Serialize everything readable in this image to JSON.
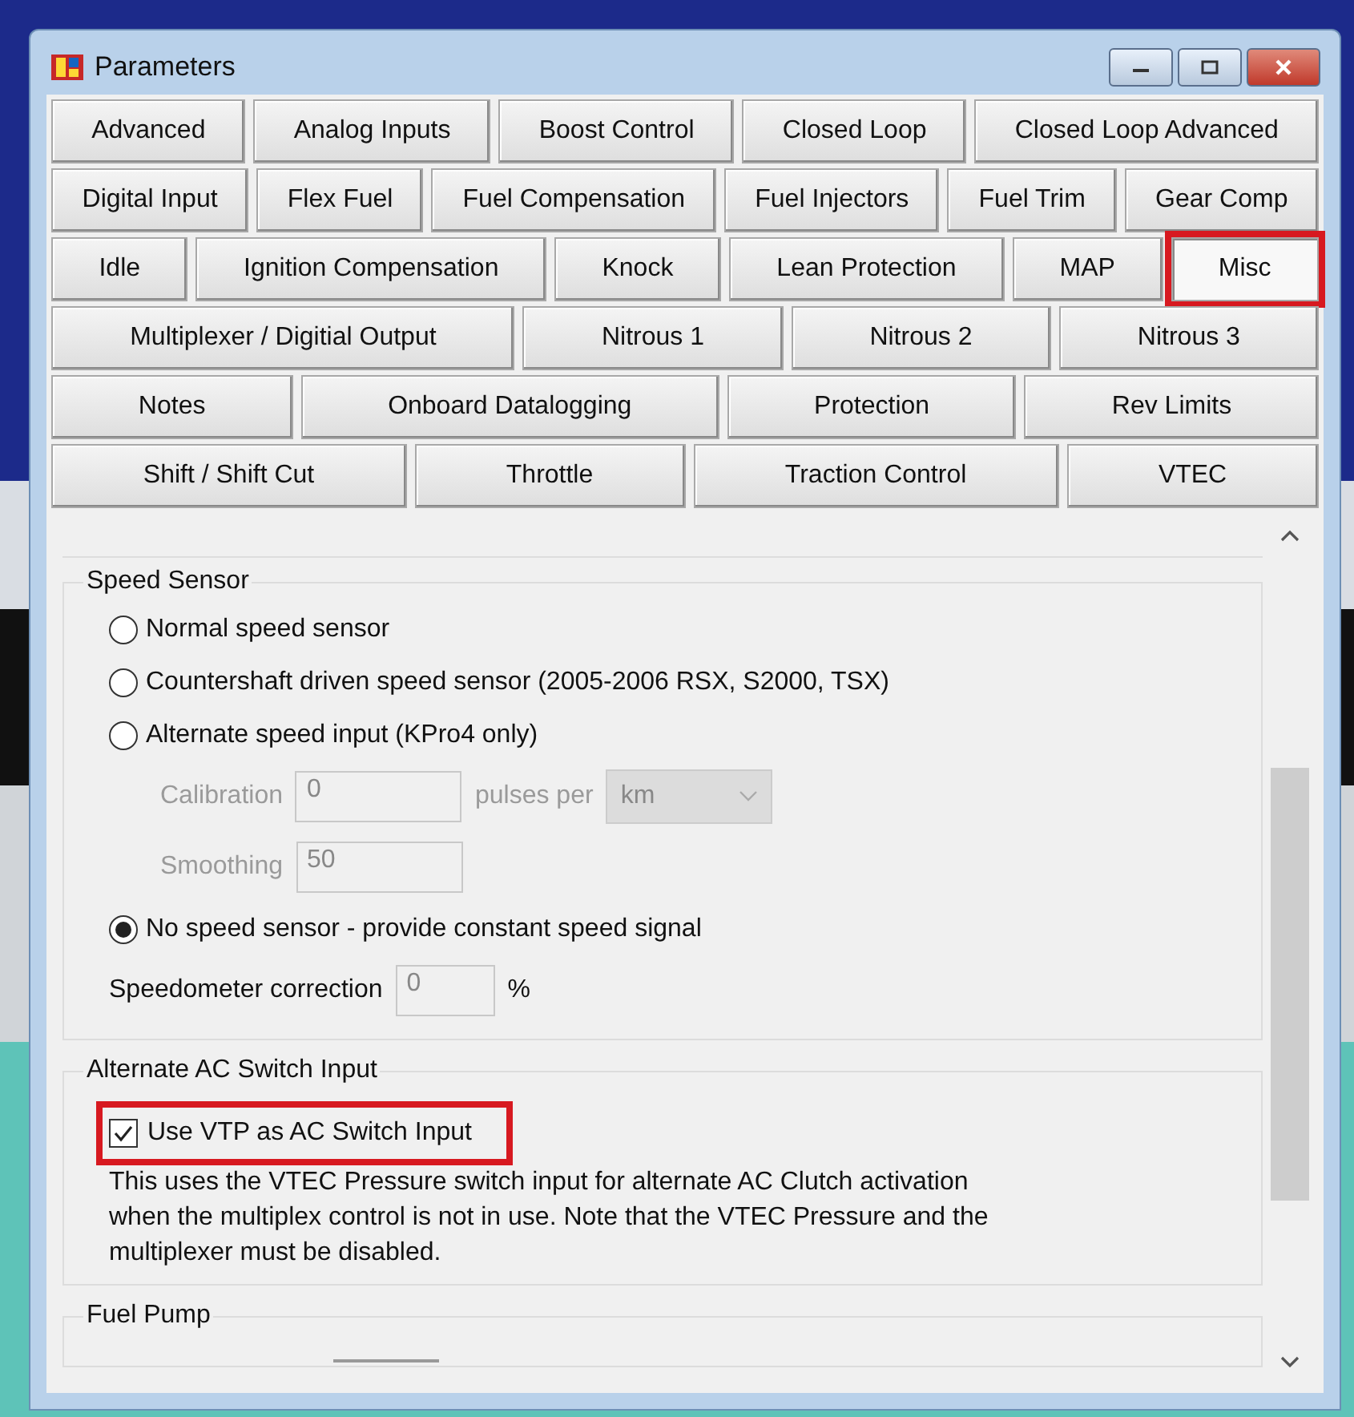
{
  "window": {
    "title": "Parameters"
  },
  "tab_rows": [
    [
      {
        "label": "Advanced",
        "selected": false,
        "highlighted": false
      },
      {
        "label": "Analog Inputs",
        "selected": false,
        "highlighted": false
      },
      {
        "label": "Boost Control",
        "selected": false,
        "highlighted": false
      },
      {
        "label": "Closed Loop",
        "selected": false,
        "highlighted": false
      },
      {
        "label": "Closed Loop Advanced",
        "selected": false,
        "highlighted": false
      }
    ],
    [
      {
        "label": "Digital Input",
        "selected": false,
        "highlighted": false
      },
      {
        "label": "Flex Fuel",
        "selected": false,
        "highlighted": false
      },
      {
        "label": "Fuel Compensation",
        "selected": false,
        "highlighted": false
      },
      {
        "label": "Fuel Injectors",
        "selected": false,
        "highlighted": false
      },
      {
        "label": "Fuel Trim",
        "selected": false,
        "highlighted": false
      },
      {
        "label": "Gear Comp",
        "selected": false,
        "highlighted": false
      }
    ],
    [
      {
        "label": "Idle",
        "selected": false,
        "highlighted": false
      },
      {
        "label": "Ignition Compensation",
        "selected": false,
        "highlighted": false
      },
      {
        "label": "Knock",
        "selected": false,
        "highlighted": false
      },
      {
        "label": "Lean Protection",
        "selected": false,
        "highlighted": false
      },
      {
        "label": "MAP",
        "selected": false,
        "highlighted": false
      },
      {
        "label": "Misc",
        "selected": true,
        "highlighted": true
      }
    ],
    [
      {
        "label": "Multiplexer / Digitial Output",
        "selected": false,
        "highlighted": false
      },
      {
        "label": "Nitrous 1",
        "selected": false,
        "highlighted": false
      },
      {
        "label": "Nitrous 2",
        "selected": false,
        "highlighted": false
      },
      {
        "label": "Nitrous 3",
        "selected": false,
        "highlighted": false
      }
    ],
    [
      {
        "label": "Notes",
        "selected": false,
        "highlighted": false
      },
      {
        "label": "Onboard Datalogging",
        "selected": false,
        "highlighted": false
      },
      {
        "label": "Protection",
        "selected": false,
        "highlighted": false
      },
      {
        "label": "Rev Limits",
        "selected": false,
        "highlighted": false
      }
    ],
    [
      {
        "label": "Shift / Shift Cut",
        "selected": false,
        "highlighted": false
      },
      {
        "label": "Throttle",
        "selected": false,
        "highlighted": false
      },
      {
        "label": "Traction Control",
        "selected": false,
        "highlighted": false
      },
      {
        "label": "VTEC",
        "selected": false,
        "highlighted": false
      }
    ]
  ],
  "speed_sensor": {
    "title": "Speed Sensor",
    "items": [
      {
        "kind": "radio",
        "label": "Normal speed sensor",
        "selected": false
      },
      {
        "kind": "radio",
        "label": "Countershaft driven speed sensor (2005-2006 RSX, S2000, TSX)",
        "selected": false
      },
      {
        "kind": "radio",
        "label": "Alternate speed input (KPro4 only)",
        "selected": false
      },
      {
        "kind": "subfield",
        "label": "Calibration",
        "value": "0",
        "unit": "pulses per",
        "dropdown": "km",
        "disabled": true
      },
      {
        "kind": "subfield",
        "label": "Smoothing",
        "value": "50",
        "disabled": true
      },
      {
        "kind": "radio",
        "label": "No speed sensor - provide constant speed signal",
        "selected": true
      },
      {
        "kind": "field",
        "label": "Speedometer correction",
        "value": "0",
        "unit": "%",
        "disabled": false
      }
    ]
  },
  "ac_switch": {
    "title": "Alternate AC Switch Input",
    "checkbox": {
      "label": "Use VTP as AC Switch Input",
      "checked": true,
      "highlighted": true
    },
    "description": "This uses the VTEC Pressure switch input for alternate AC Clutch activation when the multiplex control is not in use. Note that the VTEC Pressure and the multiplexer must be disabled."
  },
  "fuel_pump": {
    "title": "Fuel Pump"
  }
}
